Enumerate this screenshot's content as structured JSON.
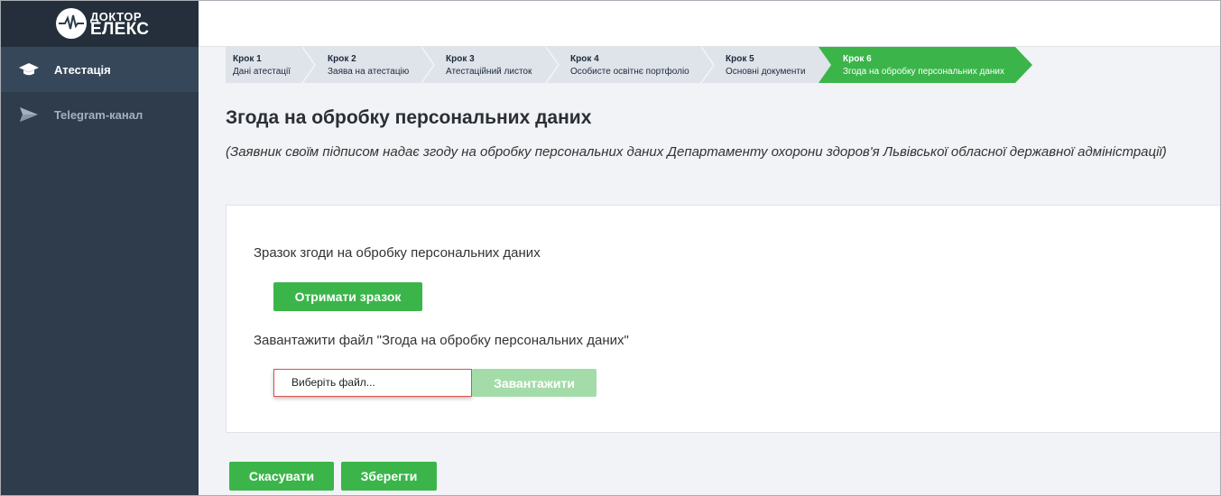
{
  "logo": {
    "line1": "ДОКТОР",
    "line2": "ЕЛЕКС"
  },
  "sidebar": {
    "items": [
      {
        "label": "Атестація",
        "icon": "graduation-cap-icon",
        "active": true
      },
      {
        "label": "Telegram-канал",
        "icon": "paper-plane-icon",
        "active": false
      }
    ]
  },
  "stepper": {
    "steps": [
      {
        "num": "Крок 1",
        "label": "Дані атестації"
      },
      {
        "num": "Крок 2",
        "label": "Заява на атестацію"
      },
      {
        "num": "Крок 3",
        "label": "Атестаційний листок"
      },
      {
        "num": "Крок 4",
        "label": "Особисте освітнє портфоліо"
      },
      {
        "num": "Крок 5",
        "label": "Основні документи"
      },
      {
        "num": "Крок 6",
        "label": "Згода на обробку персональних даних"
      }
    ],
    "active_step": 6
  },
  "page": {
    "title": "Згода на обробку персональних даних",
    "subtitle": "(Заявник своїм підписом надає згоду на обробку персональних даних Департаменту охорони здоров'я Львівської обласної державної адміністрації)"
  },
  "card": {
    "sample_label": "Зразок згоди на обробку персональних даних",
    "get_sample_button": "Отримати зразок",
    "upload_label": "Завантажити файл \"Згода на обробку персональних даних\"",
    "file_input_placeholder": "Виберіть файл...",
    "upload_button": "Завантажити"
  },
  "footer": {
    "cancel_button": "Скасувати",
    "save_button": "Зберегти"
  },
  "colors": {
    "accent_green": "#3bb54a",
    "sidebar_bg": "#2e3c4c",
    "step_inactive": "#dfe3ea",
    "highlight_red": "#d9534f"
  }
}
